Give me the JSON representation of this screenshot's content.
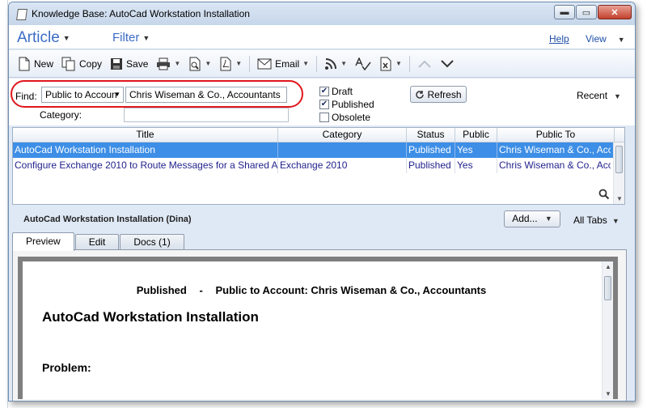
{
  "window": {
    "title": "Knowledge Base: AutoCad Workstation Installation",
    "controls": {
      "minimize": "▬",
      "maximize": "▭",
      "close": "✕"
    }
  },
  "menubar": {
    "article": "Article",
    "filter": "Filter",
    "help": "Help",
    "view": "View"
  },
  "toolbar": {
    "new": "New",
    "copy": "Copy",
    "save": "Save",
    "email": "Email"
  },
  "find": {
    "label": "Find:",
    "scope": "Public to Accoun",
    "query": "Chris Wiseman & Co., Accountants",
    "category_label": "Category:",
    "category_value": "",
    "draft_label": "Draft",
    "draft_checked": true,
    "published_label": "Published",
    "published_checked": true,
    "obsolete_label": "Obsolete",
    "obsolete_checked": false,
    "refresh": "Refresh",
    "recent": "Recent"
  },
  "grid": {
    "columns": [
      "Title",
      "Category",
      "Status",
      "Public",
      "Public To"
    ],
    "rows": [
      {
        "title": "AutoCad Workstation Installation",
        "category": "",
        "status": "Published",
        "public": "Yes",
        "public_to": "Chris Wiseman & Co., Acc",
        "selected": true
      },
      {
        "title": "Configure Exchange 2010 to Route Messages for a Shared Ad",
        "category": "Exchange 2010",
        "status": "Published",
        "public": "Yes",
        "public_to": "Chris Wiseman & Co., Acc",
        "selected": false
      }
    ]
  },
  "detail": {
    "title": "AutoCad Workstation Installation (Dina)",
    "add": "Add...",
    "all_tabs": "All Tabs",
    "tabs": [
      "Preview",
      "Edit",
      "Docs (1)"
    ],
    "active_tab": "Preview"
  },
  "preview": {
    "status": "Published",
    "dash": "-",
    "visibility": "Public to Account: Chris Wiseman & Co., Accountants",
    "doc_title": "AutoCad Workstation Installation",
    "section": "Problem:"
  },
  "colors": {
    "accent": "#3b6cc4",
    "selection": "#3d8ee6",
    "highlight": "#e0161c"
  }
}
